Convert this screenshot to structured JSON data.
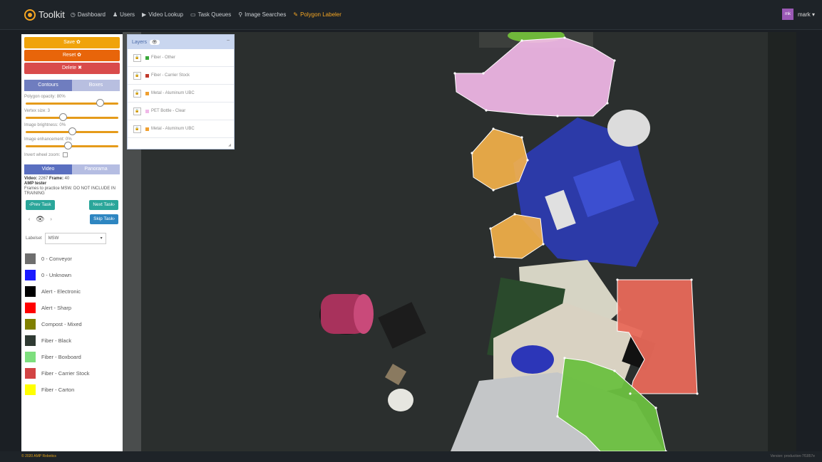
{
  "app": {
    "brand_name": "Toolkit",
    "nav": [
      {
        "icon": "dashboard-icon",
        "glyph": "◷",
        "label": "Dashboard",
        "active": false
      },
      {
        "icon": "user-icon",
        "glyph": "♟",
        "label": "Users",
        "active": false
      },
      {
        "icon": "video-icon",
        "glyph": "▶",
        "label": "Video Lookup",
        "active": false
      },
      {
        "icon": "calendar-icon",
        "glyph": "▭",
        "label": "Task Queues",
        "active": false
      },
      {
        "icon": "search-icon",
        "glyph": "⚲",
        "label": "Image Searches",
        "active": false
      },
      {
        "icon": "pencil-icon",
        "glyph": "✎",
        "label": "Polygon Labeler",
        "active": true
      }
    ],
    "user": {
      "initials": "mk",
      "name": "mark ▾"
    }
  },
  "sidebar": {
    "save_label": "Save ✿",
    "reset_label": "Reset ✿",
    "delete_label": "Delete ✖",
    "mode_tabs": [
      "Contours",
      "Boxes"
    ],
    "controls": [
      {
        "label": "Polygon opacity: 80%",
        "value": 0.8
      },
      {
        "label": "Vertex size: 3",
        "value": 0.4
      },
      {
        "label": "Image brightness: 0%",
        "value": 0.5
      },
      {
        "label": "Image enhancement: 0%",
        "value": 0.45
      }
    ],
    "invert_wheel_label": "Invert wheel zoom:",
    "view_tabs": [
      "Video",
      "Panorama"
    ],
    "video_label": "Video:",
    "video_value": "2267",
    "frame_label": "Frame:",
    "frame_value": "40",
    "task_title": "AMP tester",
    "task_desc": "Frames to practice MSW. DO NOT INCLUDE IN TRAINING",
    "prev_task": "‹Prev Task",
    "next_task": "Next Task›",
    "skip_task": "Skip Task›",
    "labelset_label": "Labelset",
    "labelset_value": "MSW",
    "legend": [
      {
        "name": "0 - Conveyor",
        "color": "#6e6e6e"
      },
      {
        "name": "0 - Unknown",
        "color": "#1a1aff"
      },
      {
        "name": "Alert - Electronic",
        "color": "#000000"
      },
      {
        "name": "Alert - Sharp",
        "color": "#ff0000"
      },
      {
        "name": "Compost - Mixed",
        "color": "#808000"
      },
      {
        "name": "Fiber - Black",
        "color": "#2f3a33"
      },
      {
        "name": "Fiber - Boxboard",
        "color": "#7ddf7d"
      },
      {
        "name": "Fiber - Carrier Stock",
        "color": "#d24343"
      },
      {
        "name": "Fiber - Carton",
        "color": "#ffff00"
      }
    ]
  },
  "layers": {
    "title": "Layers",
    "items": [
      {
        "name": "Fiber - Other",
        "color": "#3aa83a"
      },
      {
        "name": "Fiber - Carrier Stock",
        "color": "#c0392b"
      },
      {
        "name": "Metal - Aluminum UBC",
        "color": "#f0a030"
      },
      {
        "name": "PET Bottle - Clear",
        "color": "#f0b8e8"
      },
      {
        "name": "Metal - Aluminum UBC",
        "color": "#f0a030"
      }
    ]
  },
  "footer": {
    "copyright": "© 2020 AMP Robotics",
    "version": "Version: production-7f1857e"
  }
}
